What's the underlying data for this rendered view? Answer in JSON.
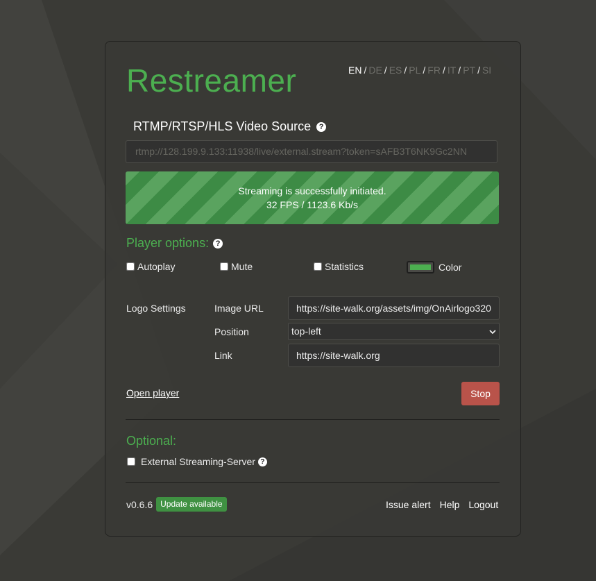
{
  "app": {
    "title": "Restreamer"
  },
  "languages": {
    "items": [
      {
        "code": "EN",
        "active": true
      },
      {
        "code": "DE",
        "active": false
      },
      {
        "code": "ES",
        "active": false
      },
      {
        "code": "PL",
        "active": false
      },
      {
        "code": "FR",
        "active": false
      },
      {
        "code": "IT",
        "active": false
      },
      {
        "code": "PT",
        "active": false
      },
      {
        "code": "SI",
        "active": false
      }
    ],
    "separator": "/"
  },
  "source": {
    "title": "RTMP/RTSP/HLS Video Source",
    "help_icon": "question-circle-icon",
    "value": "rtmp://128.199.9.133:11938/live/external.stream?token=sAFB3T6NK9Gc2NN"
  },
  "status": {
    "line1": "Streaming is successfully initiated.",
    "line2": "32 FPS / 1123.6 Kb/s",
    "color": "#3d8b45"
  },
  "player": {
    "title": "Player options:",
    "help_icon": "question-circle-icon",
    "autoplay_label": "Autoplay",
    "mute_label": "Mute",
    "statistics_label": "Statistics",
    "color_label": "Color",
    "color_value": "#4caf50",
    "autoplay_checked": false,
    "mute_checked": false,
    "statistics_checked": false
  },
  "logo_settings": {
    "label": "Logo Settings",
    "image_url_label": "Image URL",
    "image_url_value": "https://site-walk.org/assets/img/OnAirlogo320",
    "position_label": "Position",
    "position_value": "top-left",
    "link_label": "Link",
    "link_value": "https://site-walk.org"
  },
  "actions": {
    "open_player": "Open player",
    "stop": "Stop",
    "stop_color": "#b9534a"
  },
  "optional": {
    "title": "Optional:",
    "external_label": "External Streaming-Server",
    "external_checked": false,
    "help_icon": "question-circle-icon"
  },
  "footer": {
    "version": "v0.6.6",
    "update_badge": "Update available",
    "links": [
      "Issue alert",
      "Help",
      "Logout"
    ]
  },
  "colors": {
    "accent": "#4caf50",
    "background": "#3a3a36"
  }
}
